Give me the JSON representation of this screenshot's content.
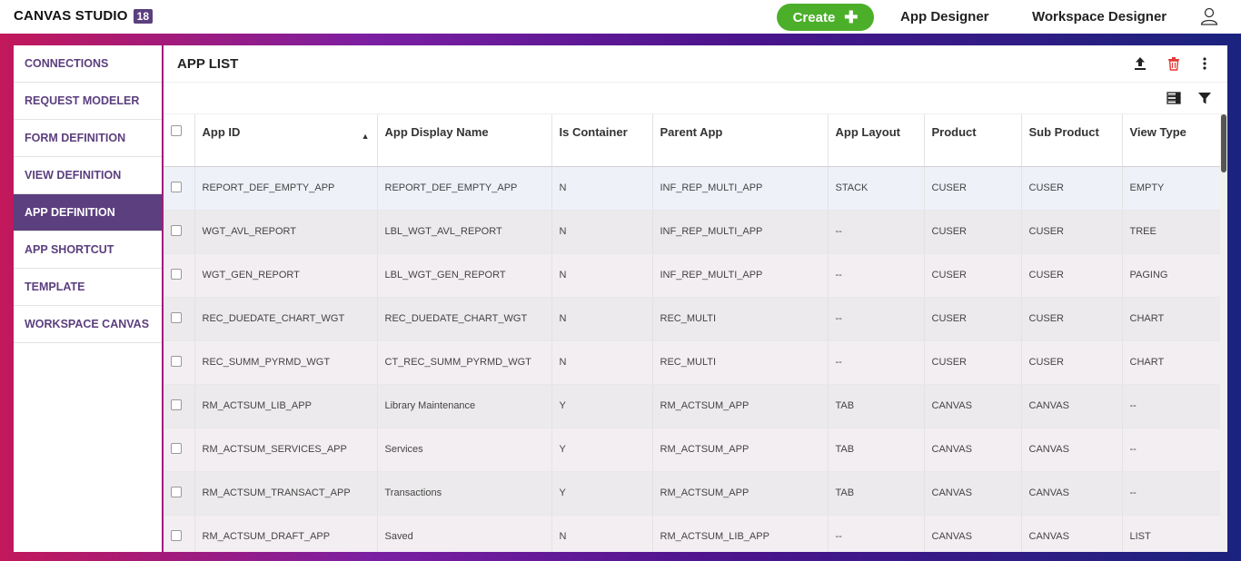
{
  "topbar": {
    "brand": "CANVAS STUDIO",
    "version": "18",
    "create_label": "Create",
    "nav": [
      "App Designer",
      "Workspace Designer"
    ]
  },
  "sidebar": {
    "items": [
      {
        "label": "CONNECTIONS",
        "active": false
      },
      {
        "label": "REQUEST MODELER",
        "active": false
      },
      {
        "label": "FORM DEFINITION",
        "active": false
      },
      {
        "label": "VIEW DEFINITION",
        "active": false
      },
      {
        "label": "APP DEFINITION",
        "active": true
      },
      {
        "label": "APP SHORTCUT",
        "active": false
      },
      {
        "label": "TEMPLATE",
        "active": false
      },
      {
        "label": "WORKSPACE CANVAS",
        "active": false
      }
    ]
  },
  "main": {
    "title": "APP LIST",
    "columns": [
      "App ID",
      "App Display Name",
      "Is Container",
      "Parent App",
      "App Layout",
      "Product",
      "Sub Product",
      "View Type"
    ],
    "rows": [
      [
        "REPORT_DEF_EMPTY_APP",
        "REPORT_DEF_EMPTY_APP",
        "N",
        "INF_REP_MULTI_APP",
        "STACK",
        "CUSER",
        "CUSER",
        "EMPTY"
      ],
      [
        "WGT_AVL_REPORT",
        "LBL_WGT_AVL_REPORT",
        "N",
        "INF_REP_MULTI_APP",
        "--",
        "CUSER",
        "CUSER",
        "TREE"
      ],
      [
        "WGT_GEN_REPORT",
        "LBL_WGT_GEN_REPORT",
        "N",
        "INF_REP_MULTI_APP",
        "--",
        "CUSER",
        "CUSER",
        "PAGING"
      ],
      [
        "REC_DUEDATE_CHART_WGT",
        "REC_DUEDATE_CHART_WGT",
        "N",
        "REC_MULTI",
        "--",
        "CUSER",
        "CUSER",
        "CHART"
      ],
      [
        "REC_SUMM_PYRMD_WGT",
        "CT_REC_SUMM_PYRMD_WGT",
        "N",
        "REC_MULTI",
        "--",
        "CUSER",
        "CUSER",
        "CHART"
      ],
      [
        "RM_ACTSUM_LIB_APP",
        "Library Maintenance",
        "Y",
        "RM_ACTSUM_APP",
        "TAB",
        "CANVAS",
        "CANVAS",
        "--"
      ],
      [
        "RM_ACTSUM_SERVICES_APP",
        "Services",
        "Y",
        "RM_ACTSUM_APP",
        "TAB",
        "CANVAS",
        "CANVAS",
        "--"
      ],
      [
        "RM_ACTSUM_TRANSACT_APP",
        "Transactions",
        "Y",
        "RM_ACTSUM_APP",
        "TAB",
        "CANVAS",
        "CANVAS",
        "--"
      ],
      [
        "RM_ACTSUM_DRAFT_APP",
        "Saved",
        "N",
        "RM_ACTSUM_LIB_APP",
        "--",
        "CANVAS",
        "CANVAS",
        "LIST"
      ]
    ]
  },
  "colors": {
    "accent": "#5b3f7e",
    "create": "#4caf2a",
    "delete": "#e53935"
  }
}
